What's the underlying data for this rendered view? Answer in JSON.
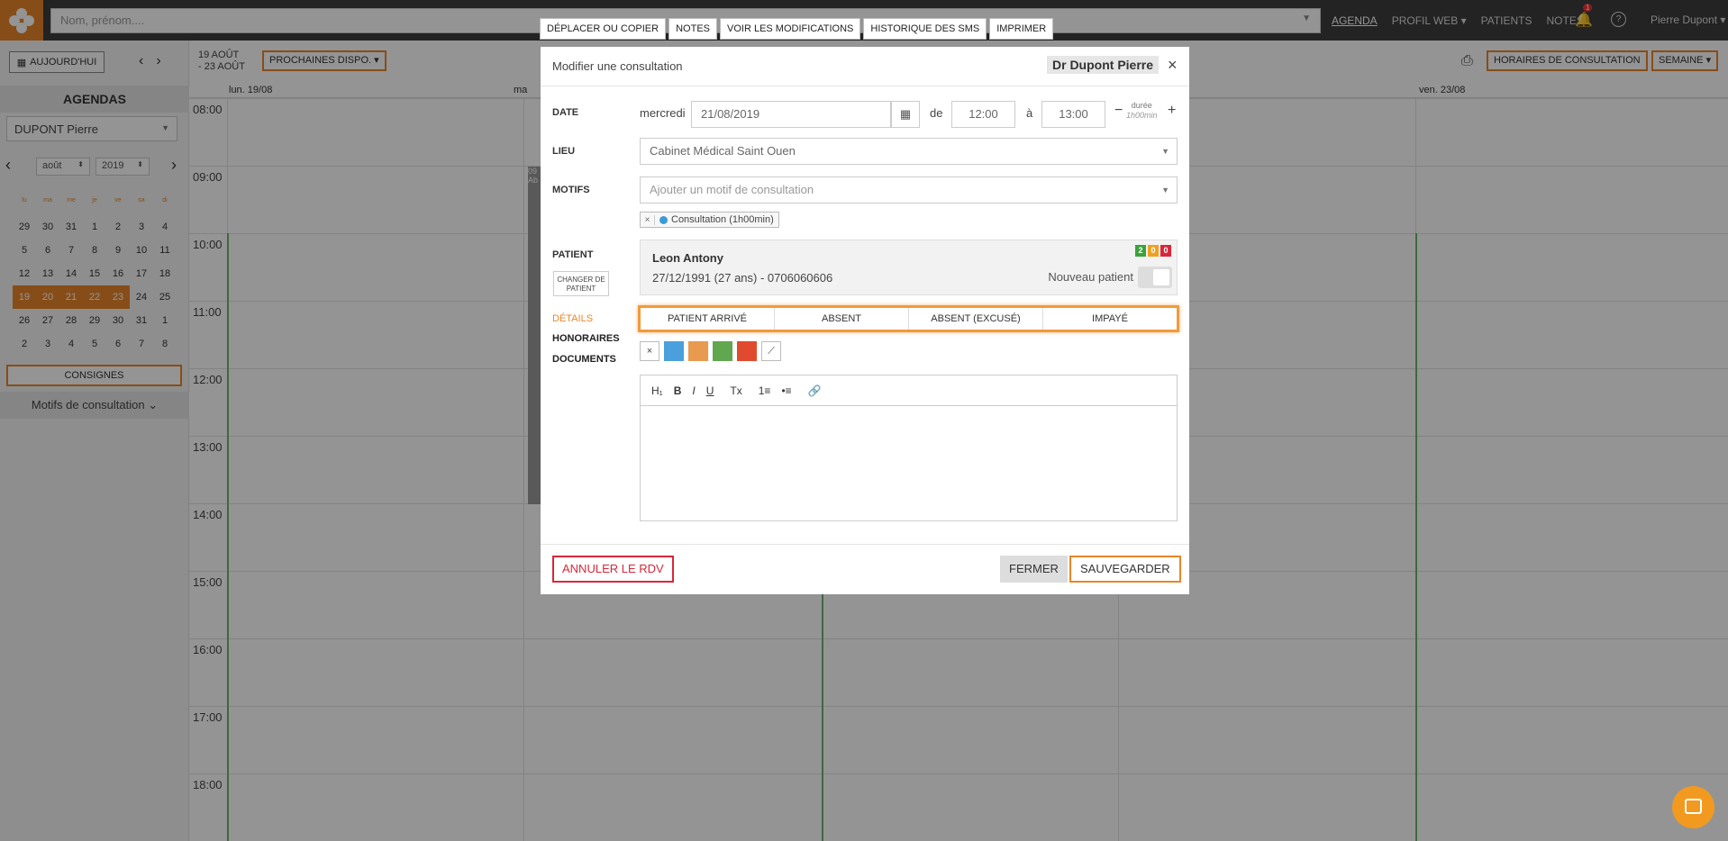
{
  "topbar": {
    "search_placeholder": "Nom, prénom....",
    "nav": [
      "AGENDA",
      "PROFIL WEB ▾",
      "PATIENTS",
      "NOTES"
    ],
    "notif_count": "1",
    "help": "?",
    "user": "Pierre Dupont ▾"
  },
  "sidebar": {
    "today": "AUJOURD'HUI",
    "agendas": "AGENDAS",
    "doctor_select": "DUPONT Pierre",
    "month": "août",
    "year": "2019",
    "weekdays": [
      "lu",
      "ma",
      "me",
      "je",
      "ve",
      "sa",
      "di"
    ],
    "weeks": [
      [
        "29",
        "30",
        "31",
        "1",
        "2",
        "3",
        "4"
      ],
      [
        "5",
        "6",
        "7",
        "8",
        "9",
        "10",
        "11"
      ],
      [
        "12",
        "13",
        "14",
        "15",
        "16",
        "17",
        "18"
      ],
      [
        "19",
        "20",
        "21",
        "22",
        "23",
        "24",
        "25"
      ],
      [
        "26",
        "27",
        "28",
        "29",
        "30",
        "31",
        "1"
      ],
      [
        "2",
        "3",
        "4",
        "5",
        "6",
        "7",
        "8"
      ]
    ],
    "consignes": "CONSIGNES",
    "motifs": "Motifs de consultation"
  },
  "calendar": {
    "range_line1": "19 AOÛT",
    "range_line2": "- 23 AOÛT",
    "prochaines": "PROCHAINES DISPO. ▾",
    "horaires": "HORAIRES DE CONSULTATION",
    "semaine": "SEMAINE ▾",
    "days": [
      "lun. 19/08",
      "ma",
      "ven. 23/08"
    ],
    "hours": [
      "08:00",
      "09:00",
      "10:00",
      "11:00",
      "12:00",
      "13:00",
      "14:00",
      "15:00",
      "16:00",
      "17:00",
      "18:00"
    ],
    "event_fragment_time": "09",
    "event_fragment_text": "Ab"
  },
  "modal_tabs": [
    "DÉPLACER OU COPIER",
    "NOTES",
    "VOIR LES MODIFICATIONS",
    "HISTORIQUE DES SMS",
    "IMPRIMER"
  ],
  "modal": {
    "title": "Modifier une consultation",
    "doctor": "Dr Dupont Pierre",
    "close": "×",
    "date_label": "DATE",
    "weekday": "mercredi",
    "date": "21/08/2019",
    "de": "de",
    "start": "12:00",
    "a": "à",
    "end": "13:00",
    "minus": "−",
    "plus": "+",
    "duree_label": "durée",
    "duree_value": "1h00min",
    "lieu_label": "LIEU",
    "lieu": "Cabinet Médical Saint Ouen",
    "motifs_label": "MOTIFS",
    "motifs_placeholder": "Ajouter un motif de consultation",
    "motif_tag": "Consultation (1h00min)",
    "patient_label": "PATIENT",
    "changer": "CHANGER DE PATIENT",
    "patient_name": "Leon Antony",
    "patient_info": "27/12/1991 (27 ans) - 0706060606",
    "counts": [
      "2",
      "0",
      "0"
    ],
    "nouveau_patient": "Nouveau patient",
    "status_buttons": [
      "PATIENT ARRIVÉ",
      "ABSENT",
      "ABSENT (EXCUSÉ)",
      "IMPAYÉ"
    ],
    "side_links": [
      "DÉTAILS",
      "HONORAIRES",
      "DOCUMENTS"
    ],
    "color_none": "×",
    "color_pick": "⟋",
    "colors": [
      "#4aa0dc",
      "#e89a4e",
      "#5fa84f",
      "#e04b2f"
    ],
    "toolbar": [
      "H₁",
      "B",
      "I",
      "U",
      "Tx",
      "1≡",
      "•≡",
      "🔗"
    ],
    "annuler": "ANNULER LE RDV",
    "fermer": "FERMER",
    "sauvegarder": "SAUVEGARDER"
  }
}
